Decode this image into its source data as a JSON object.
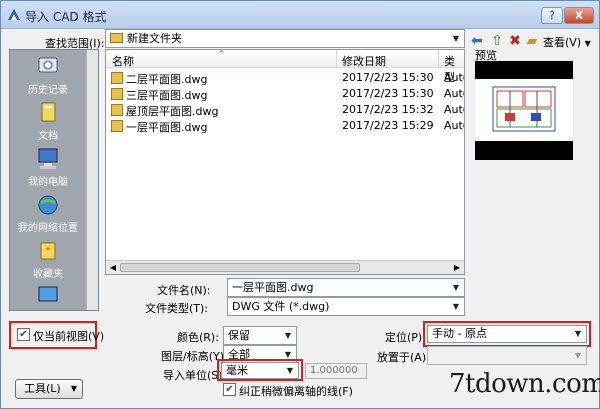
{
  "window": {
    "title": "导入 CAD 格式",
    "help_label": "?",
    "close_label": "X"
  },
  "toolbar": {
    "look_in_label": "查找范围(I):",
    "look_in_value": "新建文件夹",
    "view_label": "查看(V)"
  },
  "places": [
    {
      "label": "历史记录",
      "icon": "history-icon"
    },
    {
      "label": "文档",
      "icon": "documents-icon"
    },
    {
      "label": "我的电脑",
      "icon": "computer-icon"
    },
    {
      "label": "我的网络位置",
      "icon": "network-icon"
    },
    {
      "label": "收藏夹",
      "icon": "favorites-icon"
    }
  ],
  "file_list": {
    "columns": [
      "名称",
      "修改日期",
      "类型"
    ],
    "rows": [
      {
        "name": "二层平面图.dwg",
        "date": "2017/2/23 15:30",
        "type": "Autc"
      },
      {
        "name": "三层平面图.dwg",
        "date": "2017/2/23 15:30",
        "type": "Autc"
      },
      {
        "name": "屋顶层平面图.dwg",
        "date": "2017/2/23 15:32",
        "type": "Autc"
      },
      {
        "name": "一层平面图.dwg",
        "date": "2017/2/23 15:29",
        "type": "Autc"
      }
    ]
  },
  "preview_label": "预览",
  "file_name": {
    "label": "文件名(N):",
    "value": "一层平面图.dwg"
  },
  "file_type": {
    "label": "文件类型(T):",
    "value": "DWG 文件 (*.dwg)"
  },
  "options": {
    "current_view_only_label": "仅当前视图(V)",
    "color_label": "颜色(R):",
    "color_value": "保留",
    "layers_label": "图层/标高(Y):",
    "layers_value": "全部",
    "units_label": "导入单位(S):",
    "units_value": "毫米",
    "units_factor": "1.000000",
    "correct_lines_label": "纠正稍微偏离轴的线(F)",
    "position_label": "定位(P):",
    "position_value": "手动 - 原点",
    "place_at_label": "放置于(A):"
  },
  "tools_button": "工具(L)",
  "watermark": "7tdown.com",
  "colors": {
    "highlight_red": "#e01b1b",
    "places_bg": "#9fa6ae",
    "title_bar": "#c3d7ee"
  }
}
